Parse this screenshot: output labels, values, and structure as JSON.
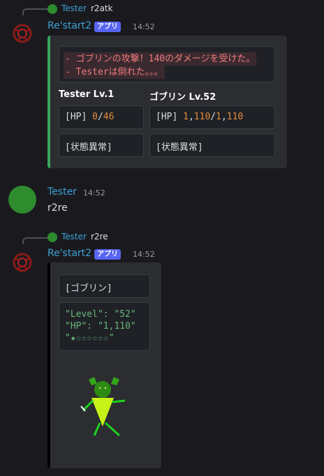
{
  "msg1": {
    "reply_user": "Tester",
    "reply_text": "r2atk",
    "author": "Re'start2",
    "app_tag": "アプリ",
    "time": "14:52",
    "log_lines": [
      "- ゴブリンの攻撃！140のダメージを受けた。",
      "- Testerは倒れた。。。"
    ],
    "player_name": "Tester Lv.1",
    "enemy_name": "ゴブリン Lv.52",
    "player_hp_label": "[HP] ",
    "player_hp_current": "0",
    "player_hp_sep": "/",
    "player_hp_max": "46",
    "enemy_hp_label": "[HP] ",
    "enemy_hp_current_a": "1",
    "enemy_hp_current_b": ",",
    "enemy_hp_current_c": "110",
    "enemy_hp_sep": "/",
    "enemy_hp_max_a": "1",
    "enemy_hp_max_b": ",",
    "enemy_hp_max_c": "110",
    "player_status": "[状態異常]",
    "enemy_status": "[状態異常]",
    "accent_color": "#3ba55d"
  },
  "msg2": {
    "author": "Tester",
    "time": "14:52",
    "text": "r2re"
  },
  "msg3": {
    "reply_user": "Tester",
    "reply_text": "r2re",
    "author": "Re'start2",
    "app_tag": "アプリ",
    "time": "14:52",
    "title_box": "[ゴブリン]",
    "json_lines": [
      "\"Level\": \"52\"",
      "\"HP\": \"1,110\"",
      "\"★☆☆☆☆☆☆\""
    ],
    "accent_color": "#000000"
  }
}
